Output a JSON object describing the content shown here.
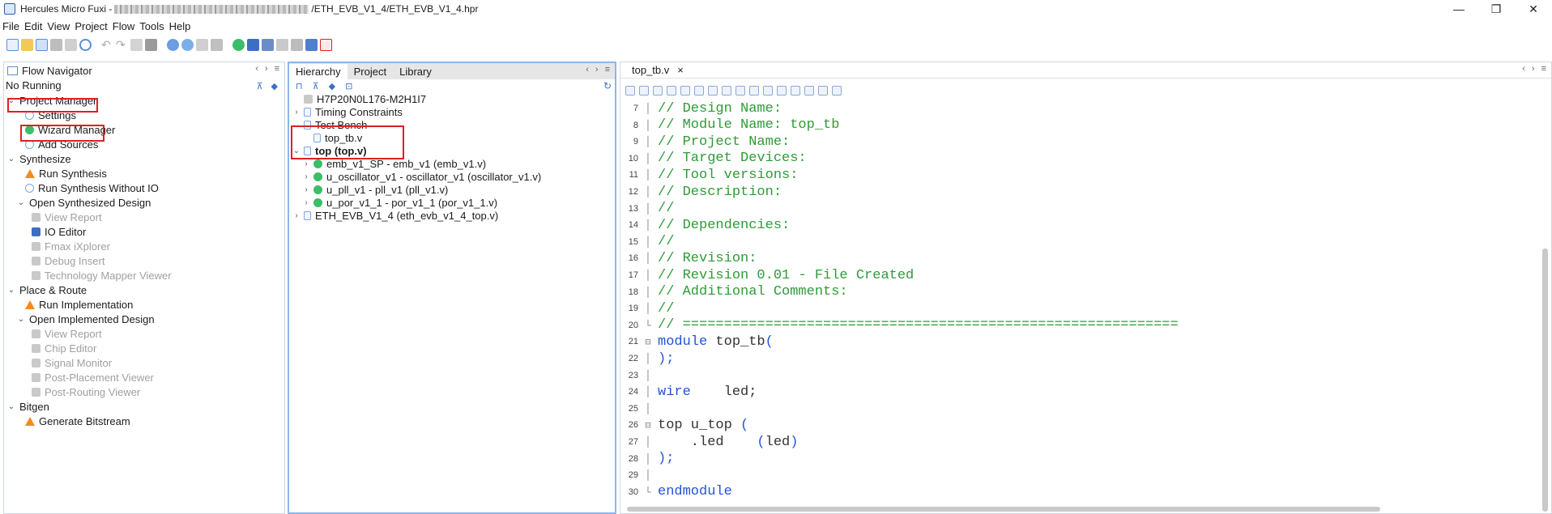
{
  "window": {
    "app_title": "Hercules Micro Fuxi -",
    "path_suffix": "/ETH_EVB_V1_4/ETH_EVB_V1_4.hpr",
    "controls": {
      "minimize": "—",
      "maximize": "❐",
      "close": "✕"
    }
  },
  "menu": [
    "File",
    "Edit",
    "View",
    "Project",
    "Flow",
    "Tools",
    "Help"
  ],
  "flow_navigator": {
    "tab": "Flow Navigator",
    "status": "No Running",
    "items": [
      {
        "label": "Project Manager",
        "level": 0,
        "chevron": "⌄",
        "icon": "none",
        "dim": false
      },
      {
        "label": "Settings",
        "level": 2,
        "chevron": "",
        "icon": "gear-icon",
        "dim": false
      },
      {
        "label": "Wizard Manager",
        "level": 2,
        "chevron": "",
        "icon": "wizard-icon",
        "dim": false
      },
      {
        "label": "Add Sources",
        "level": 2,
        "chevron": "",
        "icon": "plus-circle-icon",
        "dim": false
      },
      {
        "label": "Synthesize",
        "level": 0,
        "chevron": "⌄",
        "icon": "none",
        "dim": false
      },
      {
        "label": "Run Synthesis",
        "level": 2,
        "chevron": "",
        "icon": "warning-icon",
        "dim": false
      },
      {
        "label": "Run Synthesis Without IO",
        "level": 2,
        "chevron": "",
        "icon": "gear-icon",
        "dim": false
      },
      {
        "label": "Open Synthesized Design",
        "level": 1,
        "chevron": "⌄",
        "icon": "none",
        "dim": false
      },
      {
        "label": "View Report",
        "level": 3,
        "chevron": "",
        "icon": "report-icon",
        "dim": true
      },
      {
        "label": "IO Editor",
        "level": 3,
        "chevron": "",
        "icon": "io-icon",
        "dim": false
      },
      {
        "label": "Fmax iXplorer",
        "level": 3,
        "chevron": "",
        "icon": "fmax-icon",
        "dim": true
      },
      {
        "label": "Debug Insert",
        "level": 3,
        "chevron": "",
        "icon": "debug-icon",
        "dim": true
      },
      {
        "label": "Technology Mapper Viewer",
        "level": 3,
        "chevron": "",
        "icon": "mapper-icon",
        "dim": true
      },
      {
        "label": "Place & Route",
        "level": 0,
        "chevron": "⌄",
        "icon": "none",
        "dim": false
      },
      {
        "label": "Run Implementation",
        "level": 2,
        "chevron": "",
        "icon": "warning-icon",
        "dim": false
      },
      {
        "label": "Open Implemented Design",
        "level": 1,
        "chevron": "⌄",
        "icon": "none",
        "dim": false
      },
      {
        "label": "View Report",
        "level": 3,
        "chevron": "",
        "icon": "report-icon",
        "dim": true
      },
      {
        "label": "Chip Editor",
        "level": 3,
        "chevron": "",
        "icon": "chip-icon",
        "dim": true
      },
      {
        "label": "Signal Monitor",
        "level": 3,
        "chevron": "",
        "icon": "signal-icon",
        "dim": true
      },
      {
        "label": "Post-Placement Viewer",
        "level": 3,
        "chevron": "",
        "icon": "viewer-icon",
        "dim": true
      },
      {
        "label": "Post-Routing Viewer",
        "level": 3,
        "chevron": "",
        "icon": "viewer-icon",
        "dim": true
      },
      {
        "label": "Bitgen",
        "level": 0,
        "chevron": "⌄",
        "icon": "none",
        "dim": false
      },
      {
        "label": "Generate Bitstream",
        "level": 2,
        "chevron": "",
        "icon": "warning-icon",
        "dim": false
      }
    ]
  },
  "hierarchy": {
    "tabs": [
      "Hierarchy",
      "Project",
      "Library"
    ],
    "items": [
      {
        "label": "H7P20N0L176-M2H1I7",
        "level": 0,
        "chevron": "",
        "icon": "chip-icon",
        "bold": false
      },
      {
        "label": "Timing Constraints",
        "level": 0,
        "chevron": "›",
        "icon": "constraint-icon",
        "bold": false
      },
      {
        "label": "Test Bench",
        "level": 0,
        "chevron": "⌄",
        "icon": "testbench-icon",
        "bold": false
      },
      {
        "label": "top_tb.v",
        "level": 1,
        "chevron": "",
        "icon": "file-icon",
        "bold": false
      },
      {
        "label": "top (top.v)",
        "level": 0,
        "chevron": "⌄",
        "icon": "module-icon",
        "bold": true
      },
      {
        "label": "emb_v1_SP - emb_v1 (emb_v1.v)",
        "level": 1,
        "chevron": "›",
        "icon": "ip-icon",
        "bold": false
      },
      {
        "label": "u_oscillator_v1 - oscillator_v1 (oscillator_v1.v)",
        "level": 1,
        "chevron": "›",
        "icon": "ip-icon",
        "bold": false
      },
      {
        "label": "u_pll_v1 - pll_v1 (pll_v1.v)",
        "level": 1,
        "chevron": "›",
        "icon": "ip-icon",
        "bold": false
      },
      {
        "label": "u_por_v1_1 - por_v1_1 (por_v1_1.v)",
        "level": 1,
        "chevron": "›",
        "icon": "ip-icon",
        "bold": false
      },
      {
        "label": "ETH_EVB_V1_4 (eth_evb_v1_4_top.v)",
        "level": 0,
        "chevron": "›",
        "icon": "file-icon",
        "bold": false
      }
    ]
  },
  "editor": {
    "tab": "top_tb.v",
    "close": "×",
    "lines": [
      {
        "n": "7",
        "fold": "│",
        "parts": [
          {
            "c": "cm",
            "t": "// Design Name:"
          }
        ]
      },
      {
        "n": "8",
        "fold": "│",
        "parts": [
          {
            "c": "cm",
            "t": "// Module Name: top_tb"
          }
        ]
      },
      {
        "n": "9",
        "fold": "│",
        "parts": [
          {
            "c": "cm",
            "t": "// Project Name:"
          }
        ]
      },
      {
        "n": "10",
        "fold": "│",
        "parts": [
          {
            "c": "cm",
            "t": "// Target Devices:"
          }
        ]
      },
      {
        "n": "11",
        "fold": "│",
        "parts": [
          {
            "c": "cm",
            "t": "// Tool versions:"
          }
        ]
      },
      {
        "n": "12",
        "fold": "│",
        "parts": [
          {
            "c": "cm",
            "t": "// Description:"
          }
        ]
      },
      {
        "n": "13",
        "fold": "│",
        "parts": [
          {
            "c": "cm",
            "t": "//"
          }
        ]
      },
      {
        "n": "14",
        "fold": "│",
        "parts": [
          {
            "c": "cm",
            "t": "// Dependencies:"
          }
        ]
      },
      {
        "n": "15",
        "fold": "│",
        "parts": [
          {
            "c": "cm",
            "t": "//"
          }
        ]
      },
      {
        "n": "16",
        "fold": "│",
        "parts": [
          {
            "c": "cm",
            "t": "// Revision:"
          }
        ]
      },
      {
        "n": "17",
        "fold": "│",
        "parts": [
          {
            "c": "cm",
            "t": "// Revision 0.01 - File Created"
          }
        ]
      },
      {
        "n": "18",
        "fold": "│",
        "parts": [
          {
            "c": "cm",
            "t": "// Additional Comments:"
          }
        ]
      },
      {
        "n": "19",
        "fold": "│",
        "parts": [
          {
            "c": "cm",
            "t": "//"
          }
        ]
      },
      {
        "n": "20",
        "fold": "└",
        "parts": [
          {
            "c": "cm",
            "t": "// ============================================================"
          }
        ]
      },
      {
        "n": "21",
        "fold": "⊟",
        "parts": [
          {
            "c": "kw",
            "t": "module"
          },
          {
            "c": "tx",
            "t": " top_tb"
          },
          {
            "c": "kw",
            "t": "("
          }
        ]
      },
      {
        "n": "22",
        "fold": "│",
        "parts": [
          {
            "c": "kw",
            "t": ");"
          }
        ]
      },
      {
        "n": "23",
        "fold": "│",
        "parts": [
          {
            "c": "tx",
            "t": ""
          }
        ]
      },
      {
        "n": "24",
        "fold": "│",
        "parts": [
          {
            "c": "kw",
            "t": "wire"
          },
          {
            "c": "tx",
            "t": "    led;"
          }
        ]
      },
      {
        "n": "25",
        "fold": "│",
        "parts": [
          {
            "c": "tx",
            "t": ""
          }
        ]
      },
      {
        "n": "26",
        "fold": "⊟",
        "parts": [
          {
            "c": "tx",
            "t": "top u_top "
          },
          {
            "c": "kw",
            "t": "("
          }
        ]
      },
      {
        "n": "27",
        "fold": "│",
        "parts": [
          {
            "c": "tx",
            "t": "    .led    "
          },
          {
            "c": "kw",
            "t": "("
          },
          {
            "c": "tx",
            "t": "led"
          },
          {
            "c": "kw",
            "t": ")"
          }
        ]
      },
      {
        "n": "28",
        "fold": "│",
        "parts": [
          {
            "c": "kw",
            "t": ");"
          }
        ]
      },
      {
        "n": "29",
        "fold": "│",
        "parts": [
          {
            "c": "tx",
            "t": ""
          }
        ]
      },
      {
        "n": "30",
        "fold": "└",
        "parts": [
          {
            "c": "kw",
            "t": "endmodule"
          }
        ]
      }
    ]
  },
  "colors": {
    "highlight": "#e0201f",
    "comment": "#2e9b38",
    "keyword": "#2353d6",
    "warning": "#f08c1e"
  }
}
